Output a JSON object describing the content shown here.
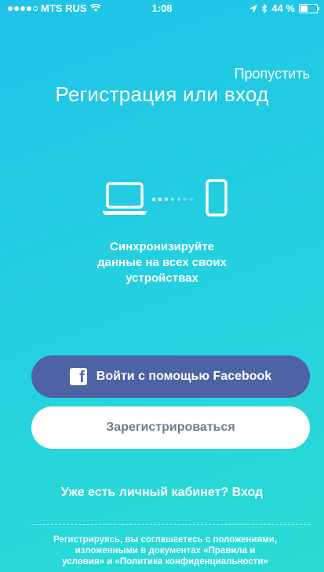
{
  "status_bar": {
    "carrier": "MTS RUS",
    "time": "1:08",
    "battery": "44 %",
    "battery_level": 0.44
  },
  "header": {
    "skip_label": "Пропустить",
    "title": "Регистрация или вход"
  },
  "sync": {
    "line1": "Синхронизируйте",
    "line2": "данные на всех своих",
    "line3": "устройствах"
  },
  "buttons": {
    "facebook_label": "Войти с помощью Facebook",
    "register_label": "Зарегистрироваться"
  },
  "login": {
    "prompt": "Уже есть личный кабинет? ",
    "link": "Вход"
  },
  "terms": {
    "line1": "Регистрируясь, вы соглашаетесь с положениями,",
    "line2_prefix": "изложенными в документах ",
    "rules_link_part1": "«Правила и",
    "rules_link_part2": "условия»",
    "conjunction": " и ",
    "privacy_link": "«Политика конфиденциальности»"
  },
  "colors": {
    "background_top": "#1fc3e8",
    "background_bottom": "#2bdcd4",
    "facebook_button": "#4d63a4",
    "register_text": "#6f7e8c"
  },
  "icons": {
    "laptop": "laptop-icon",
    "phone": "phone-icon",
    "facebook": "facebook-icon",
    "wifi": "wifi-icon",
    "location": "location-arrow-icon",
    "bluetooth": "bluetooth-icon",
    "battery": "battery-icon"
  }
}
